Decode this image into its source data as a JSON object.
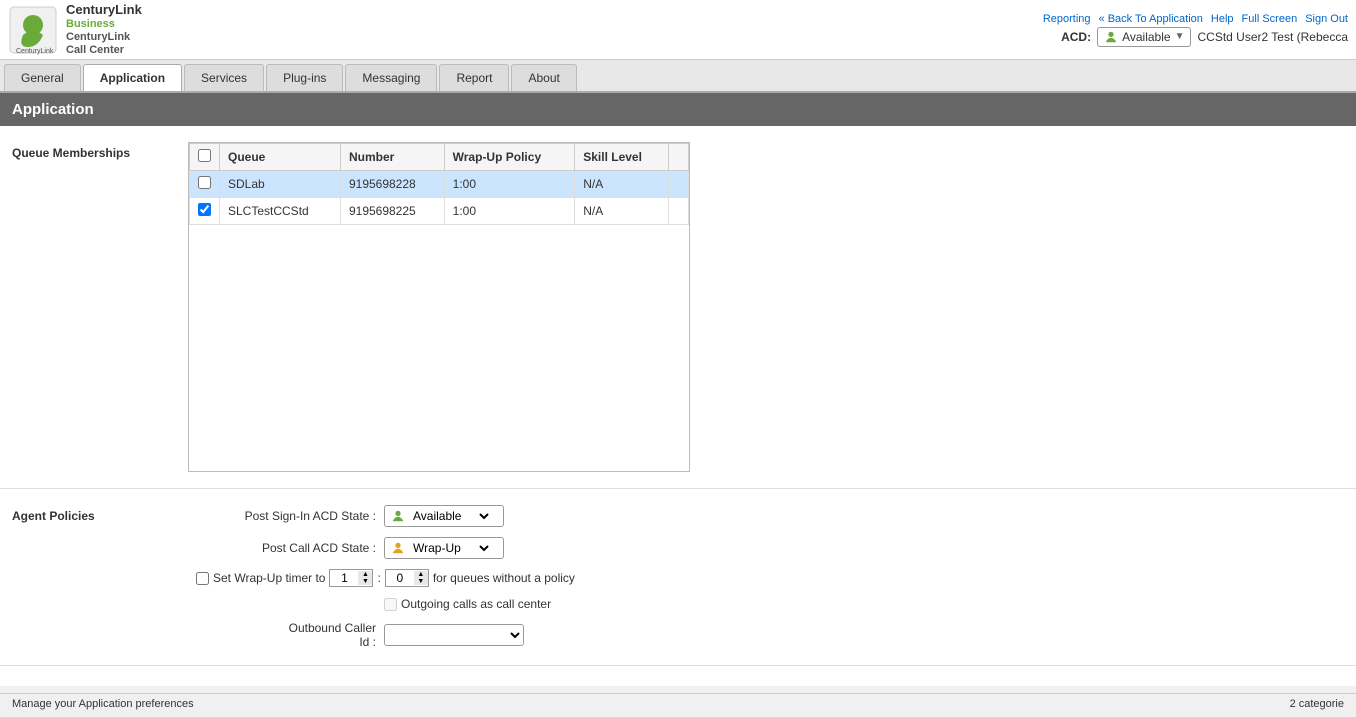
{
  "topLinks": {
    "reporting": "Reporting",
    "backToApp": "« Back To Application",
    "help": "Help",
    "fullScreen": "Full Screen",
    "signOut": "Sign Out"
  },
  "logo": {
    "line1": "CenturyLink",
    "line2": "Business",
    "line3": "CenturyLink",
    "line4": "Call Center"
  },
  "acd": {
    "label": "ACD:",
    "status": "Available",
    "user": "CCStd User2 Test (Rebecca"
  },
  "navTabs": [
    {
      "id": "general",
      "label": "General",
      "active": false
    },
    {
      "id": "application",
      "label": "Application",
      "active": true
    },
    {
      "id": "services",
      "label": "Services",
      "active": false
    },
    {
      "id": "plugins",
      "label": "Plug-ins",
      "active": false
    },
    {
      "id": "messaging",
      "label": "Messaging",
      "active": false
    },
    {
      "id": "report",
      "label": "Report",
      "active": false
    },
    {
      "id": "about",
      "label": "About",
      "active": false
    }
  ],
  "pageTitle": "Application",
  "queueMemberships": {
    "sectionLabel": "Queue Memberships",
    "columns": [
      "Queue",
      "Number",
      "Wrap-Up Policy",
      "Skill Level"
    ],
    "rows": [
      {
        "checked": false,
        "queue": "SDLab",
        "number": "9195698228",
        "wrapup": "1:00",
        "skill": "N/A",
        "selected": true
      },
      {
        "checked": true,
        "queue": "SLCTestCCStd",
        "number": "9195698225",
        "wrapup": "1:00",
        "skill": "N/A",
        "selected": false
      }
    ]
  },
  "agentPolicies": {
    "sectionLabel": "Agent Policies",
    "postSignInLabel": "Post Sign-In ACD State :",
    "postSignInValue": "Available",
    "postCallLabel": "Post Call ACD State :",
    "postCallValue": "Wrap-Up",
    "wrapUpTimerLabel": "Set Wrap-Up timer to",
    "wrapUpTimer1": "1",
    "wrapUpTimer2": "0",
    "wrapUpTimerSuffix": "for queues without a policy",
    "outgoingCallsLabel": "Outgoing calls as call center",
    "outboundCallerLabel1": "Outbound Caller",
    "outboundCallerLabel2": "Id :",
    "outboundCallerValue": ""
  },
  "statusBar": {
    "left": "Manage your Application preferences",
    "right": "2 categorie"
  }
}
